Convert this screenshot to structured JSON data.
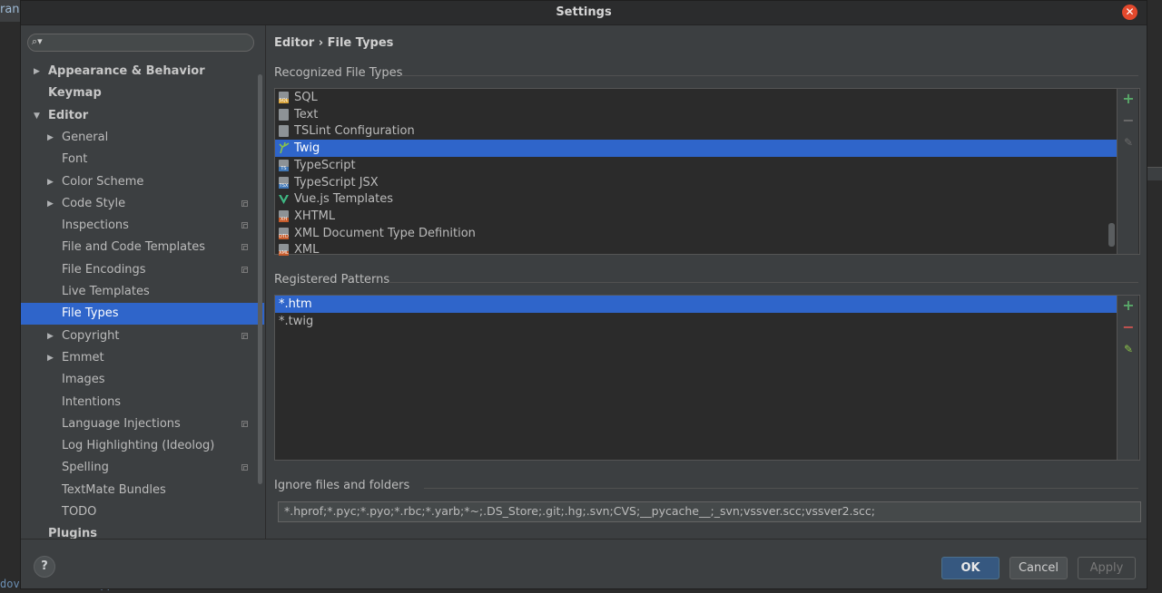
{
  "background": {
    "top_left_text": "rani",
    "bottom_left_text": "dovalitertectt/||"
  },
  "dialog": {
    "title": "Settings",
    "close_glyph": "✕"
  },
  "sidebar": {
    "search_placeholder": "",
    "items": [
      {
        "label": "Appearance & Behavior",
        "level": 0,
        "bold": true,
        "arrow": "▶",
        "copy": false
      },
      {
        "label": "Keymap",
        "level": 0,
        "bold": true,
        "arrow": "",
        "copy": false
      },
      {
        "label": "Editor",
        "level": 0,
        "bold": true,
        "arrow": "▼",
        "copy": false
      },
      {
        "label": "General",
        "level": 1,
        "bold": false,
        "arrow": "▶",
        "copy": false
      },
      {
        "label": "Font",
        "level": 1,
        "bold": false,
        "arrow": "",
        "copy": false
      },
      {
        "label": "Color Scheme",
        "level": 1,
        "bold": false,
        "arrow": "▶",
        "copy": false
      },
      {
        "label": "Code Style",
        "level": 1,
        "bold": false,
        "arrow": "▶",
        "copy": true
      },
      {
        "label": "Inspections",
        "level": 1,
        "bold": false,
        "arrow": "",
        "copy": true
      },
      {
        "label": "File and Code Templates",
        "level": 1,
        "bold": false,
        "arrow": "",
        "copy": true
      },
      {
        "label": "File Encodings",
        "level": 1,
        "bold": false,
        "arrow": "",
        "copy": true
      },
      {
        "label": "Live Templates",
        "level": 1,
        "bold": false,
        "arrow": "",
        "copy": false
      },
      {
        "label": "File Types",
        "level": 1,
        "bold": false,
        "arrow": "",
        "copy": false,
        "selected": true
      },
      {
        "label": "Copyright",
        "level": 1,
        "bold": false,
        "arrow": "▶",
        "copy": true
      },
      {
        "label": "Emmet",
        "level": 1,
        "bold": false,
        "arrow": "▶",
        "copy": false
      },
      {
        "label": "Images",
        "level": 1,
        "bold": false,
        "arrow": "",
        "copy": false
      },
      {
        "label": "Intentions",
        "level": 1,
        "bold": false,
        "arrow": "",
        "copy": false
      },
      {
        "label": "Language Injections",
        "level": 1,
        "bold": false,
        "arrow": "",
        "copy": true
      },
      {
        "label": "Log Highlighting (Ideolog)",
        "level": 1,
        "bold": false,
        "arrow": "",
        "copy": false
      },
      {
        "label": "Spelling",
        "level": 1,
        "bold": false,
        "arrow": "",
        "copy": true
      },
      {
        "label": "TextMate Bundles",
        "level": 1,
        "bold": false,
        "arrow": "",
        "copy": false
      },
      {
        "label": "TODO",
        "level": 1,
        "bold": false,
        "arrow": "",
        "copy": false
      },
      {
        "label": "Plugins",
        "level": 0,
        "bold": true,
        "arrow": "",
        "copy": false
      }
    ]
  },
  "main": {
    "breadcrumb": "Editor › File Types",
    "recognized": {
      "label": "Recognized File Types",
      "items": [
        {
          "label": "SQL",
          "icon": "sql-file-icon",
          "tag": "SQL",
          "tag_color": "#d9a43b"
        },
        {
          "label": "Text",
          "icon": "text-file-icon",
          "tag": "",
          "tag_color": ""
        },
        {
          "label": "TSLint Configuration",
          "icon": "tslint-file-icon",
          "tag": "",
          "tag_color": ""
        },
        {
          "label": "Twig",
          "icon": "twig-file-icon",
          "tag": "",
          "tag_color": "#8bc34a",
          "selected": true
        },
        {
          "label": "TypeScript",
          "icon": "typescript-file-icon",
          "tag": "TS",
          "tag_color": "#3f76b5"
        },
        {
          "label": "TypeScript JSX",
          "icon": "tsx-file-icon",
          "tag": "TSX",
          "tag_color": "#3f76b5"
        },
        {
          "label": "Vue.js Templates",
          "icon": "vue-file-icon",
          "tag": "",
          "tag_color": "#3fb883"
        },
        {
          "label": "XHTML",
          "icon": "xhtml-file-icon",
          "tag": "XH",
          "tag_color": "#c75c2c"
        },
        {
          "label": "XML Document Type Definition",
          "icon": "dtd-file-icon",
          "tag": "DTD",
          "tag_color": "#c75c2c"
        },
        {
          "label": "XML",
          "icon": "xml-file-icon",
          "tag": "XML",
          "tag_color": "#c75c2c"
        }
      ]
    },
    "patterns": {
      "label": "Registered Patterns",
      "items": [
        {
          "label": "*.htm",
          "selected": true
        },
        {
          "label": "*.twig"
        }
      ]
    },
    "ignore": {
      "label": "Ignore files and folders",
      "value": "*.hprof;*.pyc;*.pyo;*.rbc;*.yarb;*~;.DS_Store;.git;.hg;.svn;CVS;__pycache__;_svn;vssver.scc;vssver2.scc;"
    }
  },
  "toolbar_glyphs": {
    "add": "+",
    "remove": "−",
    "edit": "✎"
  },
  "colors": {
    "add": "#59a869",
    "remove": "#c75450",
    "edit": "#8bc34a",
    "disabled": "#6b6b6b"
  },
  "footer": {
    "help": "?",
    "ok": "OK",
    "cancel": "Cancel",
    "apply": "Apply"
  }
}
